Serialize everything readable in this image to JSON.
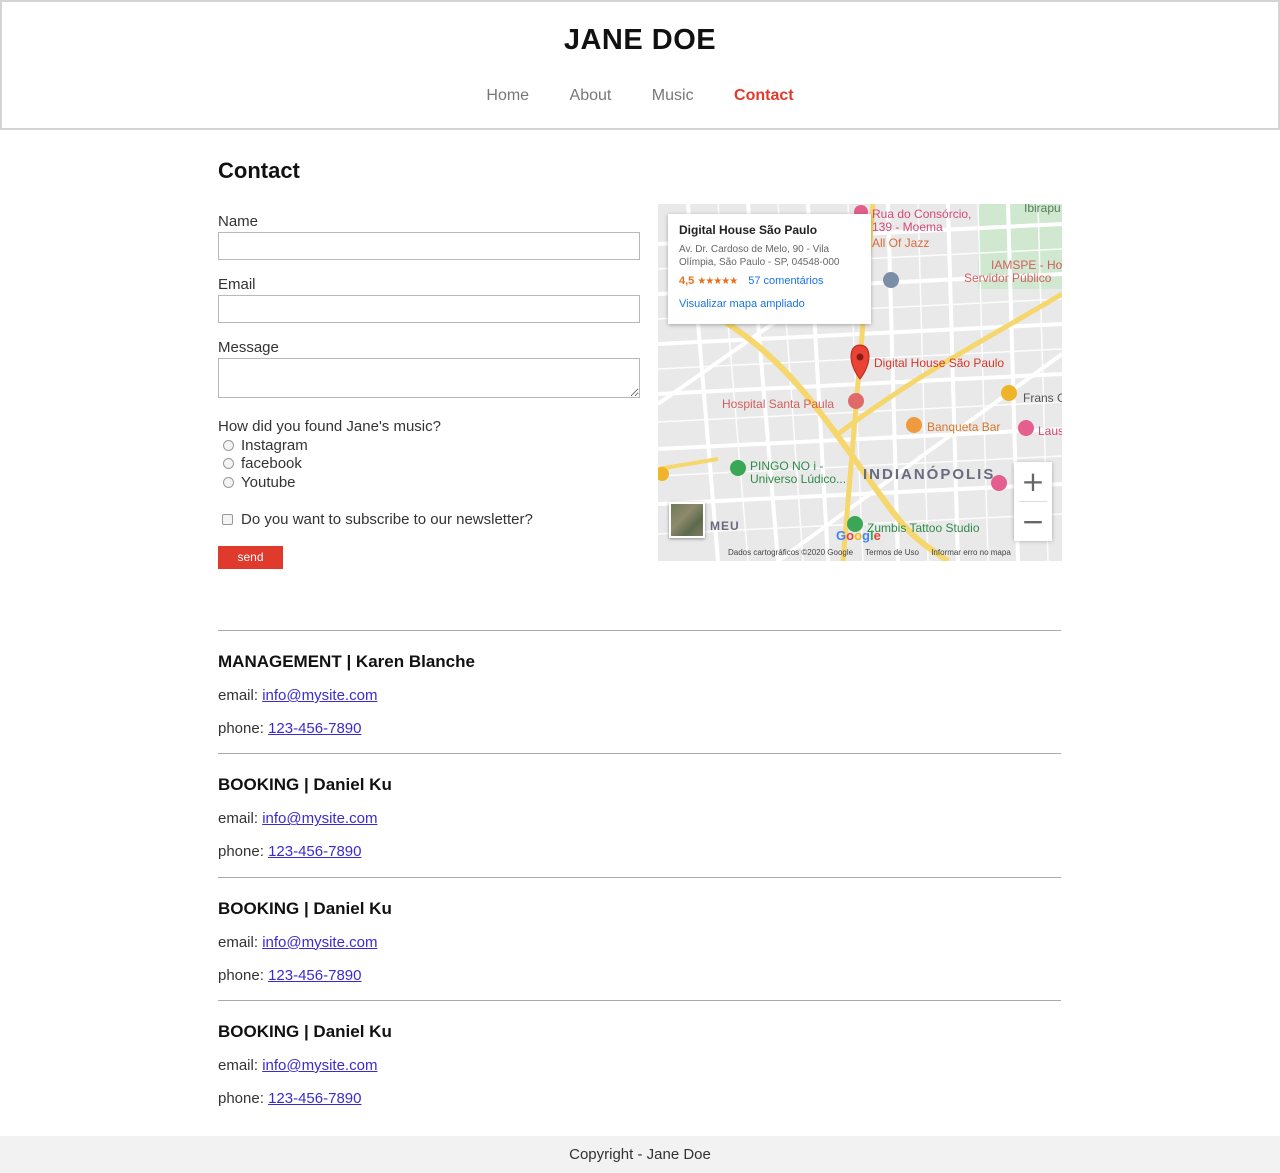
{
  "site": {
    "title": "JANE DOE"
  },
  "nav": {
    "items": [
      "Home",
      "About",
      "Music",
      "Contact"
    ],
    "active": "Contact"
  },
  "page": {
    "title": "Contact"
  },
  "form": {
    "name_label": "Name",
    "email_label": "Email",
    "message_label": "Message",
    "name_value": "",
    "email_value": "",
    "message_value": "",
    "question": "How did you found Jane's music?",
    "options": [
      "Instagram",
      "facebook",
      "Youtube"
    ],
    "newsletter_label": "Do you want to subscribe to our newsletter?",
    "send_label": "send"
  },
  "map": {
    "place_name": "Digital House São Paulo",
    "address": "Av. Dr. Cardoso de Melo, 90 - Vila Olímpia, São Paulo - SP, 04548-000",
    "rating": "4,5",
    "stars": "★★★★★",
    "reviews": "57 comentários",
    "enlarge_link": "Visualizar mapa ampliado",
    "labels": {
      "rua": "Rua do Consórcio,",
      "moema": "139 - Moema",
      "jazz": "All Of Jazz",
      "ibirapu": "Ibirapu",
      "iamspe": "IAMSPE - Ho",
      "servidor": "Servidor Público",
      "pin_label": "Digital House São Paulo",
      "frans": "Frans C",
      "hospital": "Hospital Santa Paula",
      "banqueta": "Banqueta Bar",
      "laus": "Laus",
      "pingo1": "PINGO NO i -",
      "pingo2": "Universo Lúdico...",
      "indianopolis": "INDIANÓPOLIS",
      "meu": "MEU",
      "zumbis": "Zumbis Tattoo Studio"
    },
    "google": "Google",
    "attribution": [
      "Dados cartográficos ©2020 Google",
      "Termos de Uso",
      "Informar erro no mapa"
    ],
    "zoom_in": "+",
    "zoom_out": "−"
  },
  "contacts": [
    {
      "heading": "MANAGEMENT | Karen Blanche",
      "email_prefix": "email:",
      "email": "info@mysite.com",
      "phone_prefix": "phone:",
      "phone": "123-456-7890"
    },
    {
      "heading": "BOOKING | Daniel Ku",
      "email_prefix": "email:",
      "email": "info@mysite.com",
      "phone_prefix": "phone:",
      "phone": "123-456-7890"
    },
    {
      "heading": "BOOKING | Daniel Ku",
      "email_prefix": "email:",
      "email": "info@mysite.com",
      "phone_prefix": "phone:",
      "phone": "123-456-7890"
    },
    {
      "heading": "BOOKING | Daniel Ku",
      "email_prefix": "email:",
      "email": "info@mysite.com",
      "phone_prefix": "phone:",
      "phone": "123-456-7890"
    }
  ],
  "footer": {
    "copyright": "Copyright - Jane Doe"
  },
  "colors": {
    "accent": "#e03a2c",
    "link": "#3a2bd1",
    "map_pin": "#ea4335"
  }
}
